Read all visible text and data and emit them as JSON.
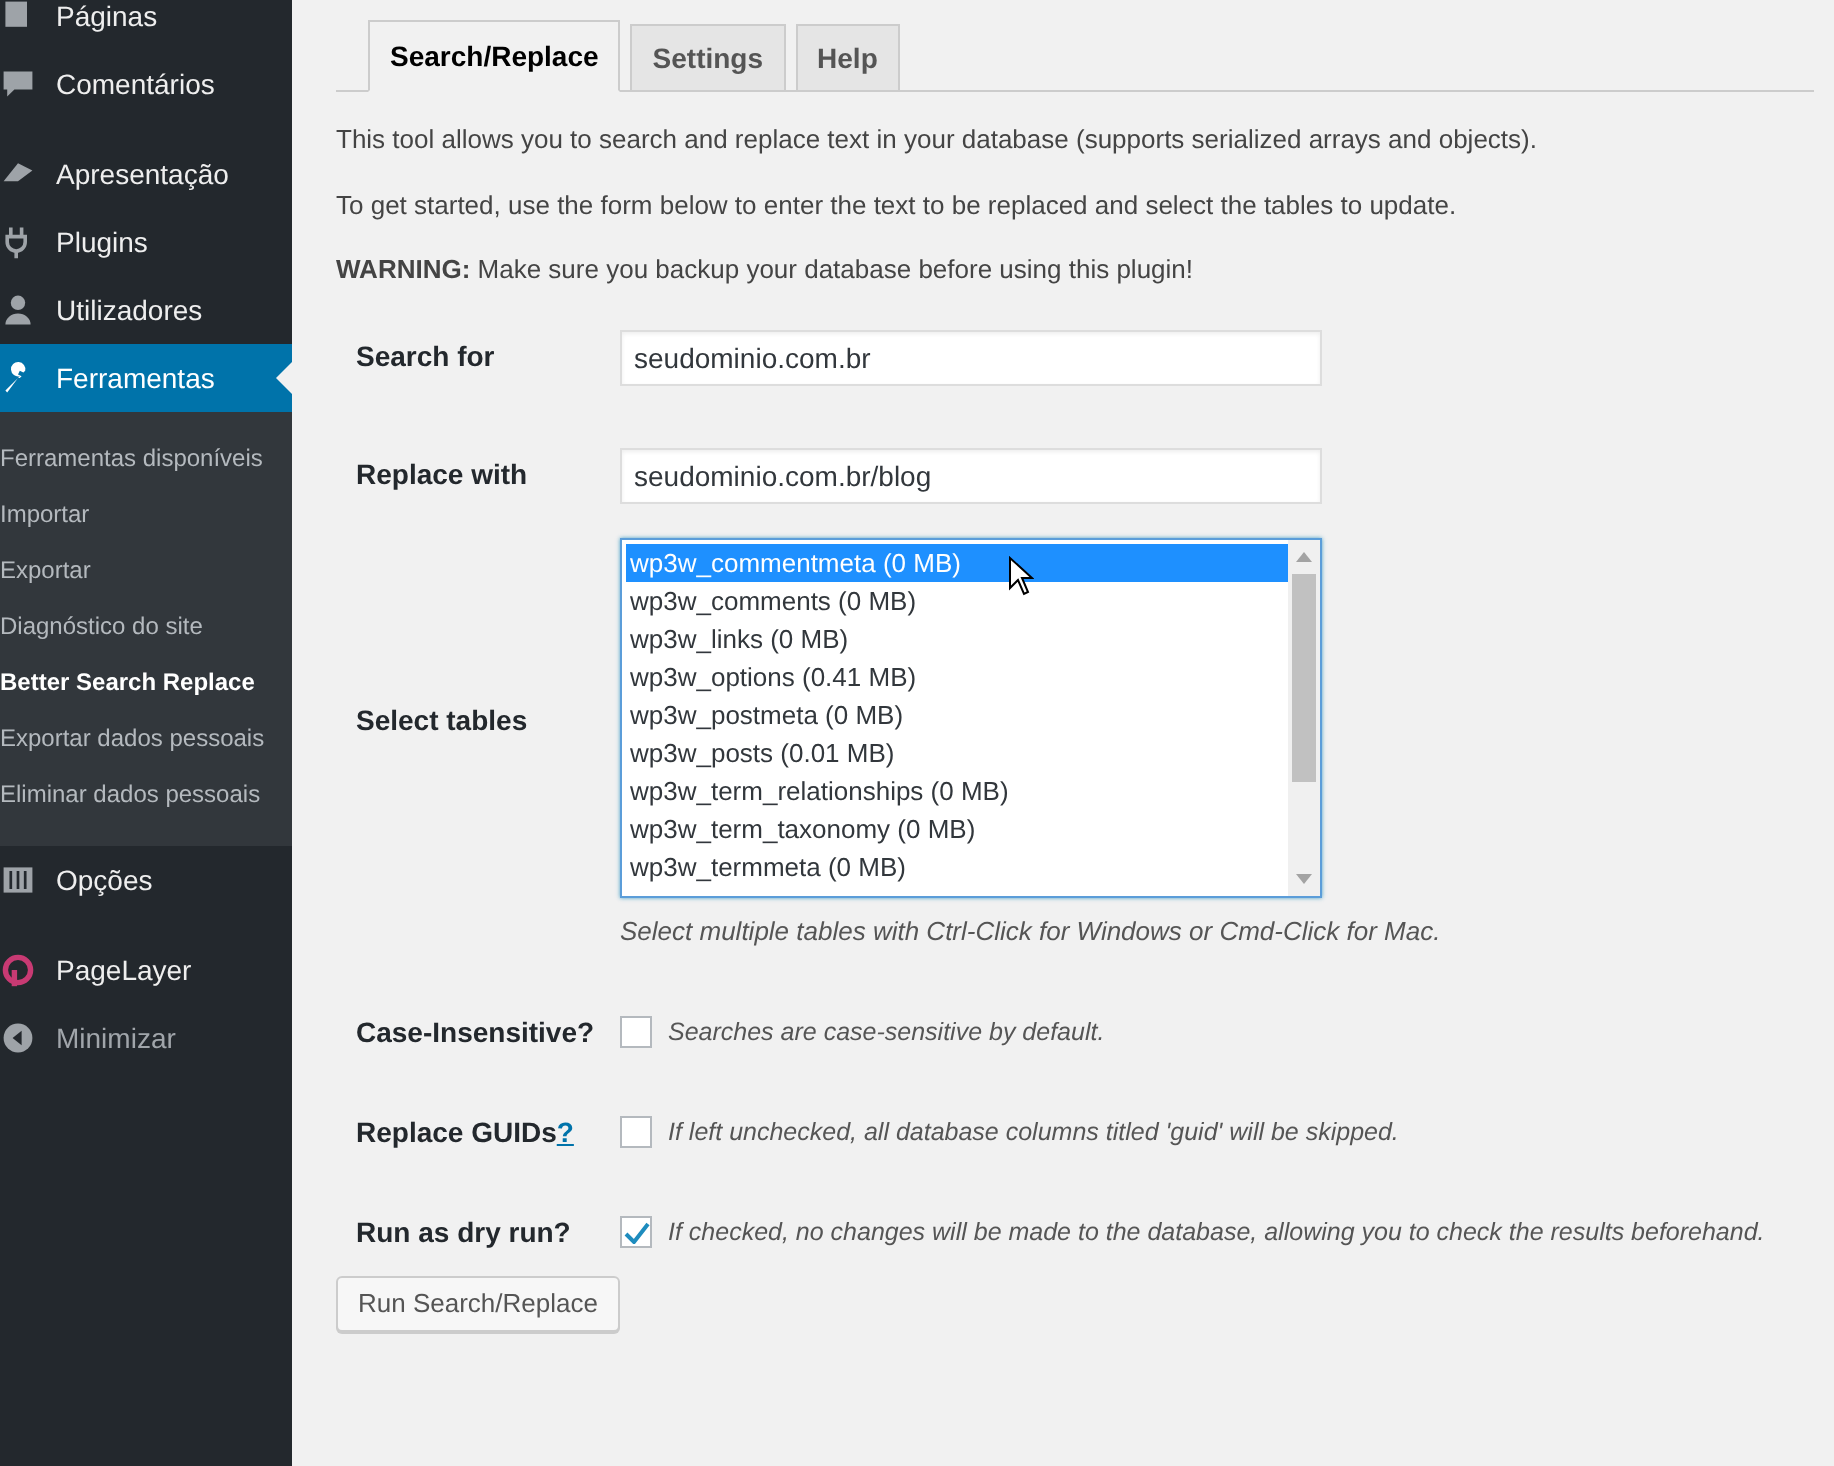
{
  "sidebar": {
    "menu_groups": [
      [
        {
          "label": "Páginas",
          "kind": "menu",
          "active": false
        },
        {
          "label": "Comentários",
          "kind": "menu",
          "active": false
        }
      ],
      [
        {
          "label": "Apresentação",
          "kind": "menu",
          "active": false
        },
        {
          "label": "Plugins",
          "kind": "menu",
          "active": false
        },
        {
          "label": "Utilizadores",
          "kind": "menu",
          "active": false
        },
        {
          "label": "Ferramentas",
          "kind": "menu",
          "active": true,
          "children": [
            {
              "label": "Ferramentas disponíveis",
              "selected": false
            },
            {
              "label": "Importar",
              "selected": false
            },
            {
              "label": "Exportar",
              "selected": false
            },
            {
              "label": "Diagnóstico do site",
              "selected": false
            },
            {
              "label": "Better Search Replace",
              "selected": true
            },
            {
              "label": "Exportar dados pessoais",
              "selected": false
            },
            {
              "label": "Eliminar dados pessoais",
              "selected": false
            }
          ]
        },
        {
          "label": "Opções",
          "kind": "menu",
          "active": false
        }
      ],
      [
        {
          "label": "PageLayer",
          "kind": "menu",
          "active": false
        },
        {
          "label": "Minimizar",
          "kind": "collapse",
          "active": false
        }
      ]
    ]
  },
  "tabs": [
    {
      "label": "Search/Replace",
      "selected": true
    },
    {
      "label": "Settings",
      "selected": false
    },
    {
      "label": "Help",
      "selected": false
    }
  ],
  "intro": [
    "This tool allows you to search and replace text in your database (supports serialized arrays and objects).",
    "To get started, use the form below to enter the text to be replaced and select the tables to update.",
    "**WARNING:** Make sure you backup your database before using this plugin!"
  ],
  "search_for": {
    "label": "Search for",
    "value": "seudominio.com.br"
  },
  "replace_with": {
    "label": "Replace with",
    "value": "seudominio.com.br/blog"
  },
  "select_tables": {
    "label": "Select tables",
    "hint": "Select multiple tables with Ctrl-Click for Windows or Cmd-Click for Mac.",
    "options": [
      {
        "label": "wp3w_commentmeta (0 MB)",
        "selected": true
      },
      {
        "label": "wp3w_comments (0 MB)",
        "selected": false
      },
      {
        "label": "wp3w_links (0 MB)",
        "selected": false
      },
      {
        "label": "wp3w_options (0.41 MB)",
        "selected": false
      },
      {
        "label": "wp3w_postmeta (0 MB)",
        "selected": false
      },
      {
        "label": "wp3w_posts (0.01 MB)",
        "selected": false
      },
      {
        "label": "wp3w_term_relationships (0 MB)",
        "selected": false
      },
      {
        "label": "wp3w_term_taxonomy (0 MB)",
        "selected": false
      },
      {
        "label": "wp3w_termmeta (0 MB)",
        "selected": false
      }
    ]
  },
  "options": [
    {
      "label": "Case-Insensitive?",
      "description": "Searches are case-sensitive by default.",
      "checked": false
    },
    {
      "label": "Replace GUIDs",
      "help_link": "?",
      "description": "If left unchecked, all database columns titled 'guid' will be skipped.",
      "checked": false
    },
    {
      "label": "Run as dry run?",
      "description": "If checked, no changes will be made to the database, allowing you to check the results beforehand.",
      "checked": true
    }
  ],
  "submit_button": "Run Search/Replace"
}
